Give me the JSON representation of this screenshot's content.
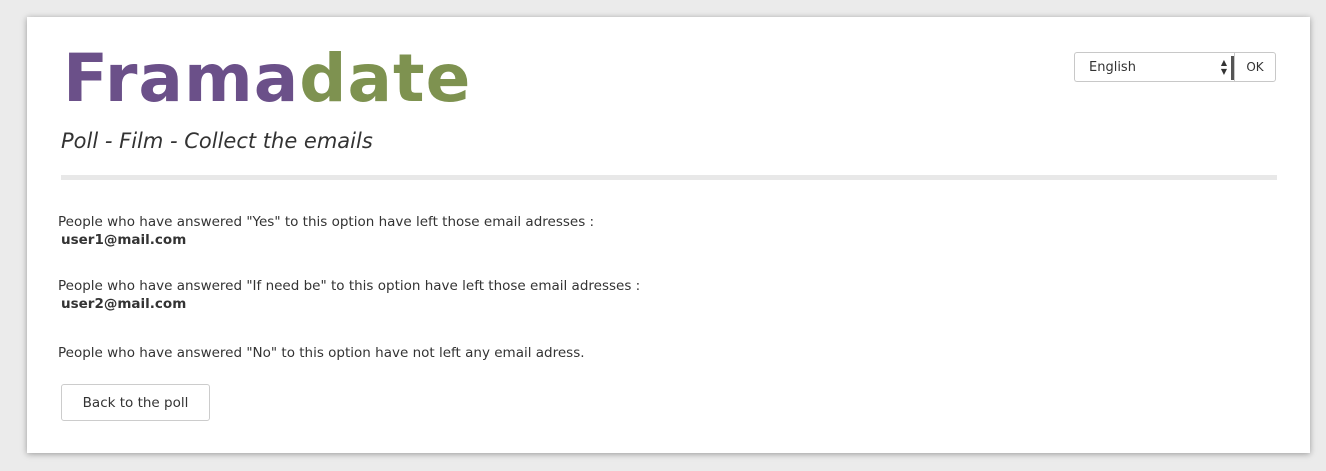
{
  "logo": {
    "part1": "Frama",
    "part2": "date"
  },
  "subtitle": "Poll - Film - Collect the emails",
  "language": {
    "selected": "English",
    "ok_label": "OK"
  },
  "sections": [
    {
      "text": "People who have answered \"Yes\" to this option have left those email adresses :",
      "email": "user1@mail.com"
    },
    {
      "text": "People who have answered \"If need be\" to this option have left those email adresses :",
      "email": "user2@mail.com"
    },
    {
      "text": "People who have answered \"No\" to this option have not left any email adress."
    }
  ],
  "back_button_label": "Back to the poll"
}
